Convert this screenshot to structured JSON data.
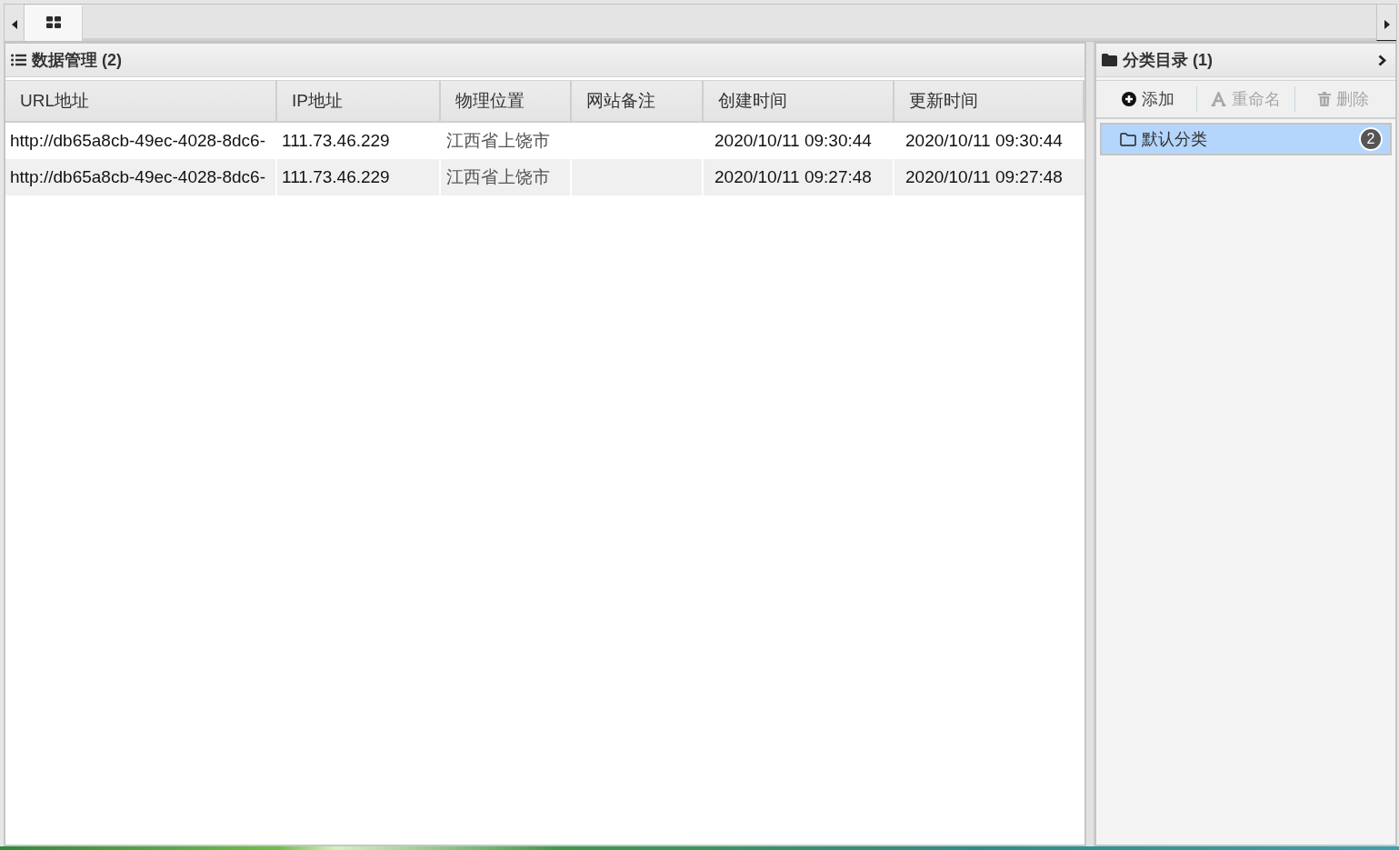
{
  "tab_strip": {
    "tabs": [
      {
        "selected": true
      }
    ]
  },
  "data_panel": {
    "title": "数据管理 (2)",
    "table": {
      "columns": [
        "URL地址",
        "IP地址",
        "物理位置",
        "网站备注",
        "创建时间",
        "更新时间"
      ],
      "rows": [
        {
          "url": "http://db65a8cb-49ec-4028-8dc6-",
          "ip": "111.73.46.229",
          "location": "江西省上饶市",
          "created": "2020/10/11 09:30:44",
          "updated": "2020/10/11 09:30:44"
        },
        {
          "url": "http://db65a8cb-49ec-4028-8dc6-",
          "ip": "111.73.46.229",
          "location": "江西省上饶市",
          "created": "2020/10/11 09:27:48",
          "updated": "2020/10/11 09:27:48"
        }
      ]
    }
  },
  "category_panel": {
    "title": "分类目录 (1)",
    "toolbar": [
      {
        "kind": "add",
        "label": "添加",
        "disabled": false
      },
      {
        "kind": "rename",
        "label": "重命名",
        "disabled": true
      },
      {
        "kind": "delete",
        "label": "删除",
        "disabled": true
      }
    ],
    "items": [
      {
        "label": "默认分类",
        "count": "2",
        "selected": true
      }
    ]
  }
}
